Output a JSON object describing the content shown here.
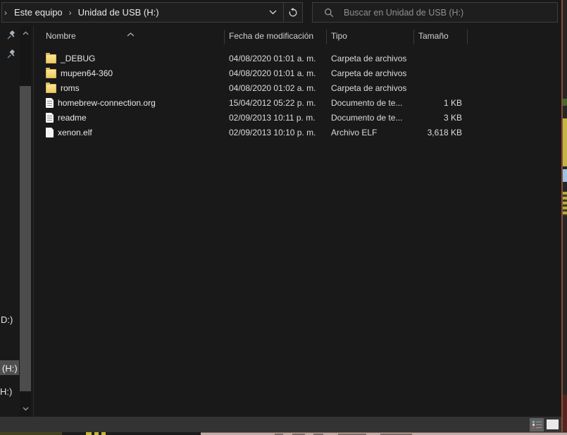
{
  "window": {
    "kind": "file-explorer",
    "theme": "dark",
    "language": "es"
  },
  "address_bar": {
    "leading_separator": "›",
    "separator": "›",
    "breadcrumbs": [
      "Este equipo",
      "Unidad de USB (H:)"
    ],
    "dropdown_icon": "chevron-down",
    "refresh_icon": "refresh-arrow"
  },
  "search": {
    "placeholder": "Buscar en Unidad de USB (H:)",
    "icon": "magnifier"
  },
  "list": {
    "columns": [
      {
        "id": "name",
        "label": "Nombre",
        "sorted": "ascending"
      },
      {
        "id": "date",
        "label": "Fecha de modificación"
      },
      {
        "id": "type",
        "label": "Tipo"
      },
      {
        "id": "size",
        "label": "Tamaño"
      }
    ],
    "files": [
      {
        "name": "_DEBUG",
        "icon": "folder",
        "date": "04/08/2020 01:01 a. m.",
        "type": "Carpeta de archivos",
        "size": ""
      },
      {
        "name": "mupen64-360",
        "icon": "folder",
        "date": "04/08/2020 01:01 a. m.",
        "type": "Carpeta de archivos",
        "size": ""
      },
      {
        "name": "roms",
        "icon": "folder",
        "date": "04/08/2020 01:02 a. m.",
        "type": "Carpeta de archivos",
        "size": ""
      },
      {
        "name": "homebrew-connection.org",
        "icon": "textdoc",
        "date": "15/04/2012 05:22 p. m.",
        "type": "Documento de te...",
        "size": "1 KB"
      },
      {
        "name": "readme",
        "icon": "textdoc",
        "date": "02/09/2013 10:11 p. m.",
        "type": "Documento de te...",
        "size": "3 KB"
      },
      {
        "name": "xenon.elf",
        "icon": "file",
        "date": "02/09/2013 10:10 p. m.",
        "type": "Archivo ELF",
        "size": "3,618 KB"
      }
    ]
  },
  "sidebar": {
    "pinned_icons": [
      "pin",
      "pin"
    ],
    "partial_items": [
      {
        "label": "D:)",
        "selected": false
      },
      {
        "label": "(H:)",
        "selected": true
      },
      {
        "label": "H:)",
        "selected": false
      }
    ]
  },
  "status_bar": {
    "view_buttons": [
      {
        "id": "details-view",
        "active": true
      },
      {
        "id": "thumbnail-view",
        "active": false
      }
    ]
  },
  "colors": {
    "window_bg": "#191919",
    "box_bg": "#1e1e1e",
    "box_border": "#3e3e3e",
    "selection_bg": "#4f4f4f",
    "folder_yellow": "#f3d87a",
    "status_bar_bg": "#333333",
    "screen_edge_accent": "#8f4a33"
  }
}
